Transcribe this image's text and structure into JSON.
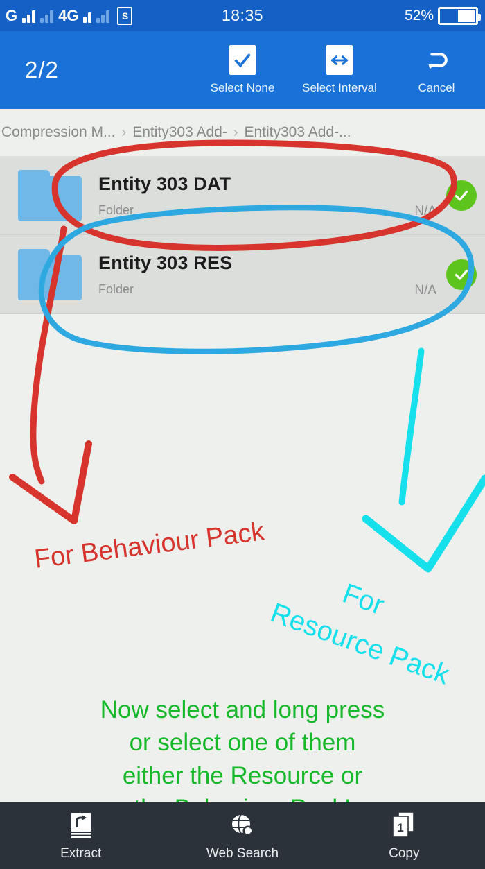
{
  "statusbar": {
    "network_label_1": "G",
    "network_label_2": "4G",
    "app_icon_letter": "S",
    "clock": "18:35",
    "battery_percent": "52%"
  },
  "actionbar": {
    "counter": "2/2",
    "actions": [
      {
        "label": "Select None",
        "icon": "checkbox-check-icon"
      },
      {
        "label": "Select Interval",
        "icon": "left-right-arrow-icon"
      },
      {
        "label": "Cancel",
        "icon": "undo-arrow-icon"
      }
    ]
  },
  "breadcrumb": {
    "separator": "›",
    "items": [
      "Compression M...",
      "Entity303 Add-",
      "Entity303 Add-..."
    ]
  },
  "filelist": {
    "rows": [
      {
        "name": "Entity 303 DAT",
        "type": "Folder",
        "size": "N/A",
        "selected": true
      },
      {
        "name": "Entity 303 RES",
        "type": "Folder",
        "size": "N/A",
        "selected": true
      }
    ]
  },
  "annotations": {
    "red_text": "For Behaviour Pack",
    "cyan_text_line1": "For",
    "cyan_text_line2": "Resource Pack",
    "green_lines": [
      "Now select and long press",
      "or select one of them",
      "either the Resource or",
      "the Behaviour Pack!"
    ],
    "colors": {
      "red": "#D6342C",
      "blue": "#2EA8E0",
      "cyan": "#16E0EC",
      "green": "#17B82A"
    }
  },
  "bottombar": {
    "items": [
      {
        "label": "Extract",
        "icon": "extract-icon"
      },
      {
        "label": "Web Search",
        "icon": "globe-search-icon"
      },
      {
        "label": "Copy",
        "icon": "copy-pages-icon",
        "badge": "1"
      }
    ]
  },
  "theme": {
    "statusbar_blue": "#1560C4",
    "actionbar_blue": "#1A72D8",
    "page_background": "#EDF0EC",
    "row_background": "#DCDEDC",
    "folder_blue": "#6FB8E8",
    "check_green": "#5DC41E",
    "bottombar_dark": "#2C3239"
  }
}
